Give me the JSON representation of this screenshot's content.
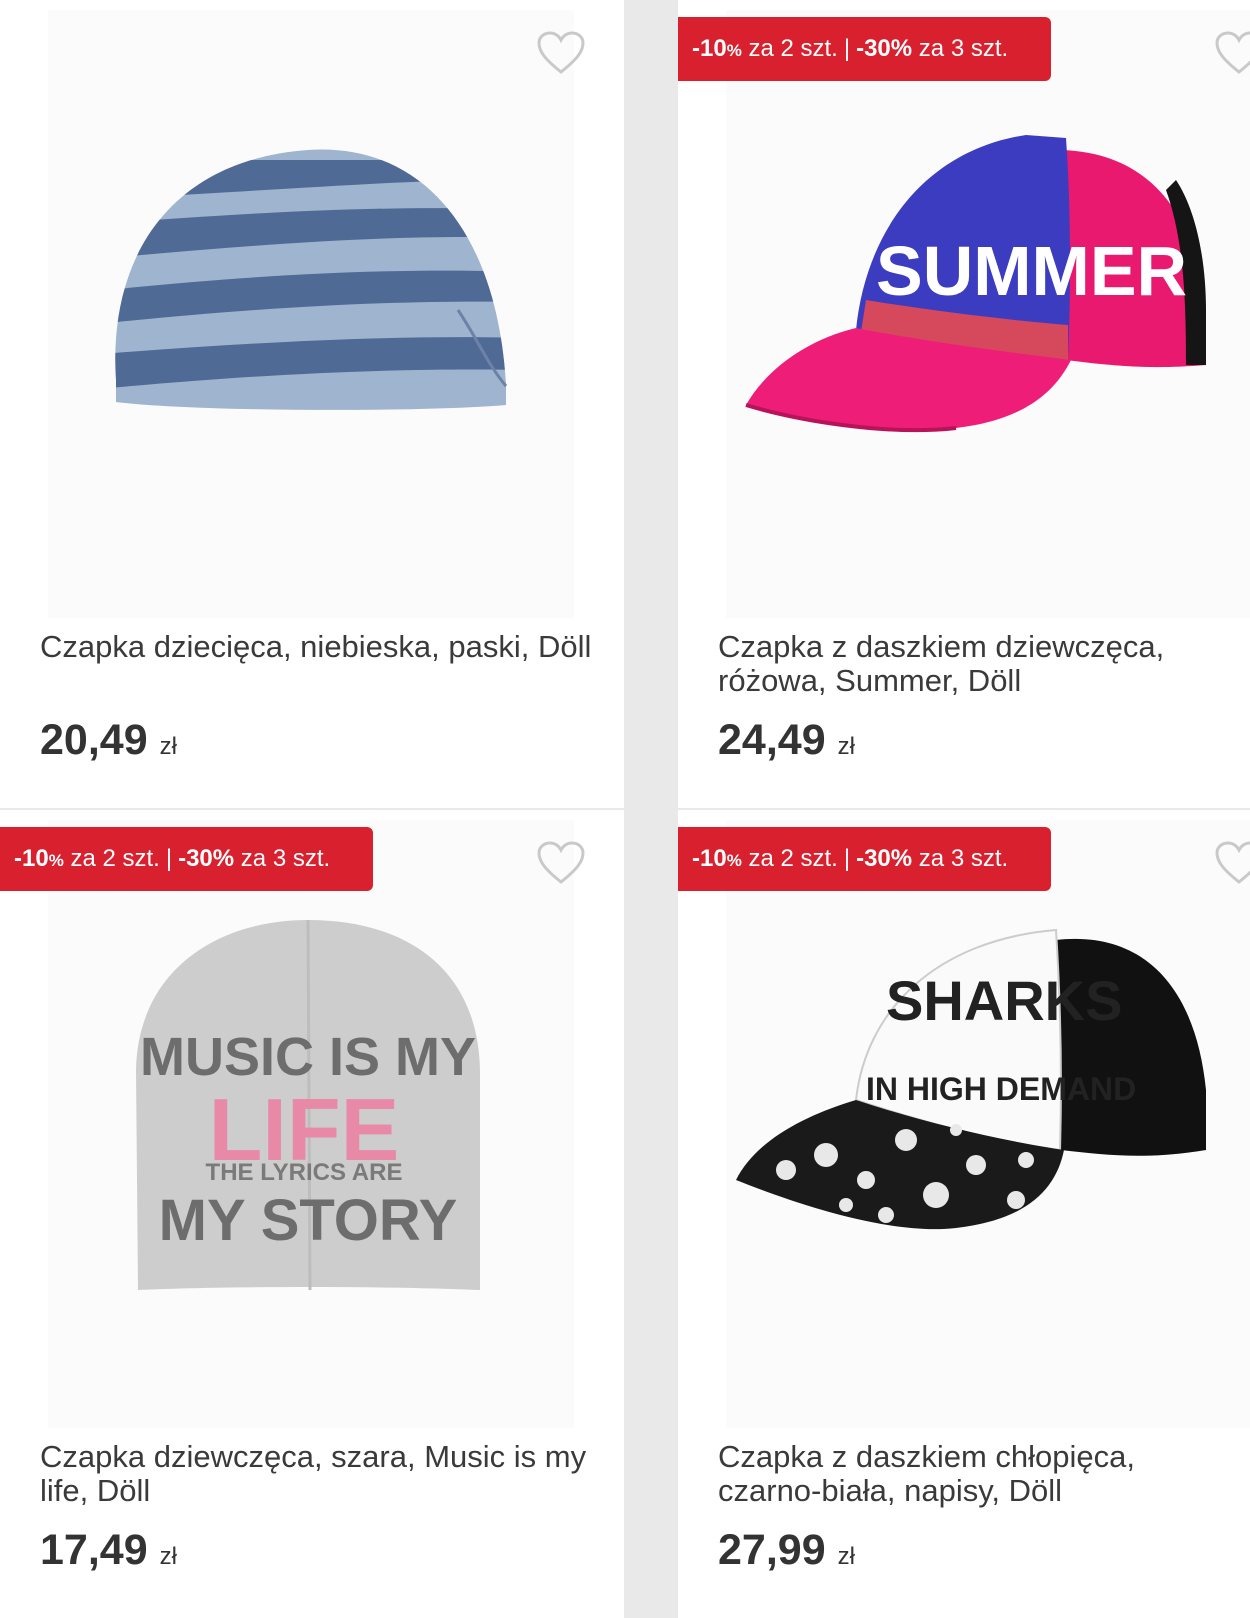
{
  "products": [
    {
      "title": "Czapka dziecięca, niebieska, paski, Döll",
      "price": "20,49",
      "currency": "zł",
      "badge": null
    },
    {
      "title": "Czapka z daszkiem dziewczęca, różowa, Summer, Döll",
      "price": "24,49",
      "currency": "zł",
      "badge": {
        "first_value": "-10",
        "first_pct": "%",
        "first_text": "za 2 szt.",
        "separator": "|",
        "second_value": "-30%",
        "second_text": "za 3 szt."
      }
    },
    {
      "title": "Czapka dziewczęca, szara, Music is my life, Döll",
      "price": "17,49",
      "currency": "zł",
      "badge": {
        "first_value": "-10",
        "first_pct": "%",
        "first_text": "za 2 szt.",
        "separator": "|",
        "second_value": "-30%",
        "second_text": "za 3 szt."
      },
      "image_text": {
        "line1": "MUSIC IS MY",
        "line2": "LIFE",
        "line3": "THE LYRICS ARE",
        "line4": "MY STORY"
      }
    },
    {
      "title": "Czapka z daszkiem chłopięca, czarno-biała, napisy, Döll",
      "price": "27,99",
      "currency": "zł",
      "badge": {
        "first_value": "-10",
        "first_pct": "%",
        "first_text": "za 2 szt.",
        "separator": "|",
        "second_value": "-30%",
        "second_text": "za 3 szt."
      },
      "image_text": {
        "line1": "SHARKS",
        "line2": "IN HIGH DEMAND"
      }
    }
  ],
  "summer_cap_text": "SUMMER",
  "colors": {
    "badge": "#d8202e",
    "page_bg": "#e9e9e9"
  },
  "icons": {
    "favorite": "heart-outline-icon"
  }
}
